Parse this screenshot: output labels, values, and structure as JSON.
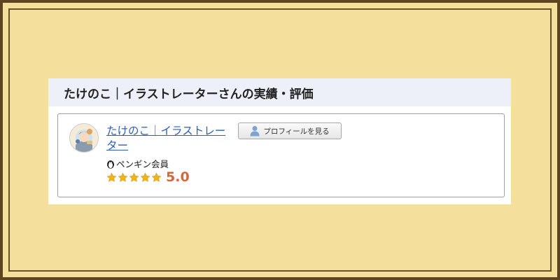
{
  "page": {
    "title": "たけのこ｜イラストレーターさんの実績・評価"
  },
  "profile": {
    "name": "たけのこ｜イラストレーター",
    "view_profile_label": "プロフィールを見る",
    "membership": "ペンギン会員",
    "rating_value": "5.0",
    "stars_filled": 5,
    "stars_total": 5
  },
  "icons": {
    "avatar": "illustrator-avatar",
    "profile_button": "person-icon",
    "membership": "penguin-icon",
    "rating": "star-icon"
  },
  "colors": {
    "frame_background": "#f4e09c",
    "frame_border": "#6b5128",
    "header_background": "#edf0f8",
    "link": "#2c5eb8",
    "rating_text": "#d9663a",
    "star": "#f2b21e"
  }
}
